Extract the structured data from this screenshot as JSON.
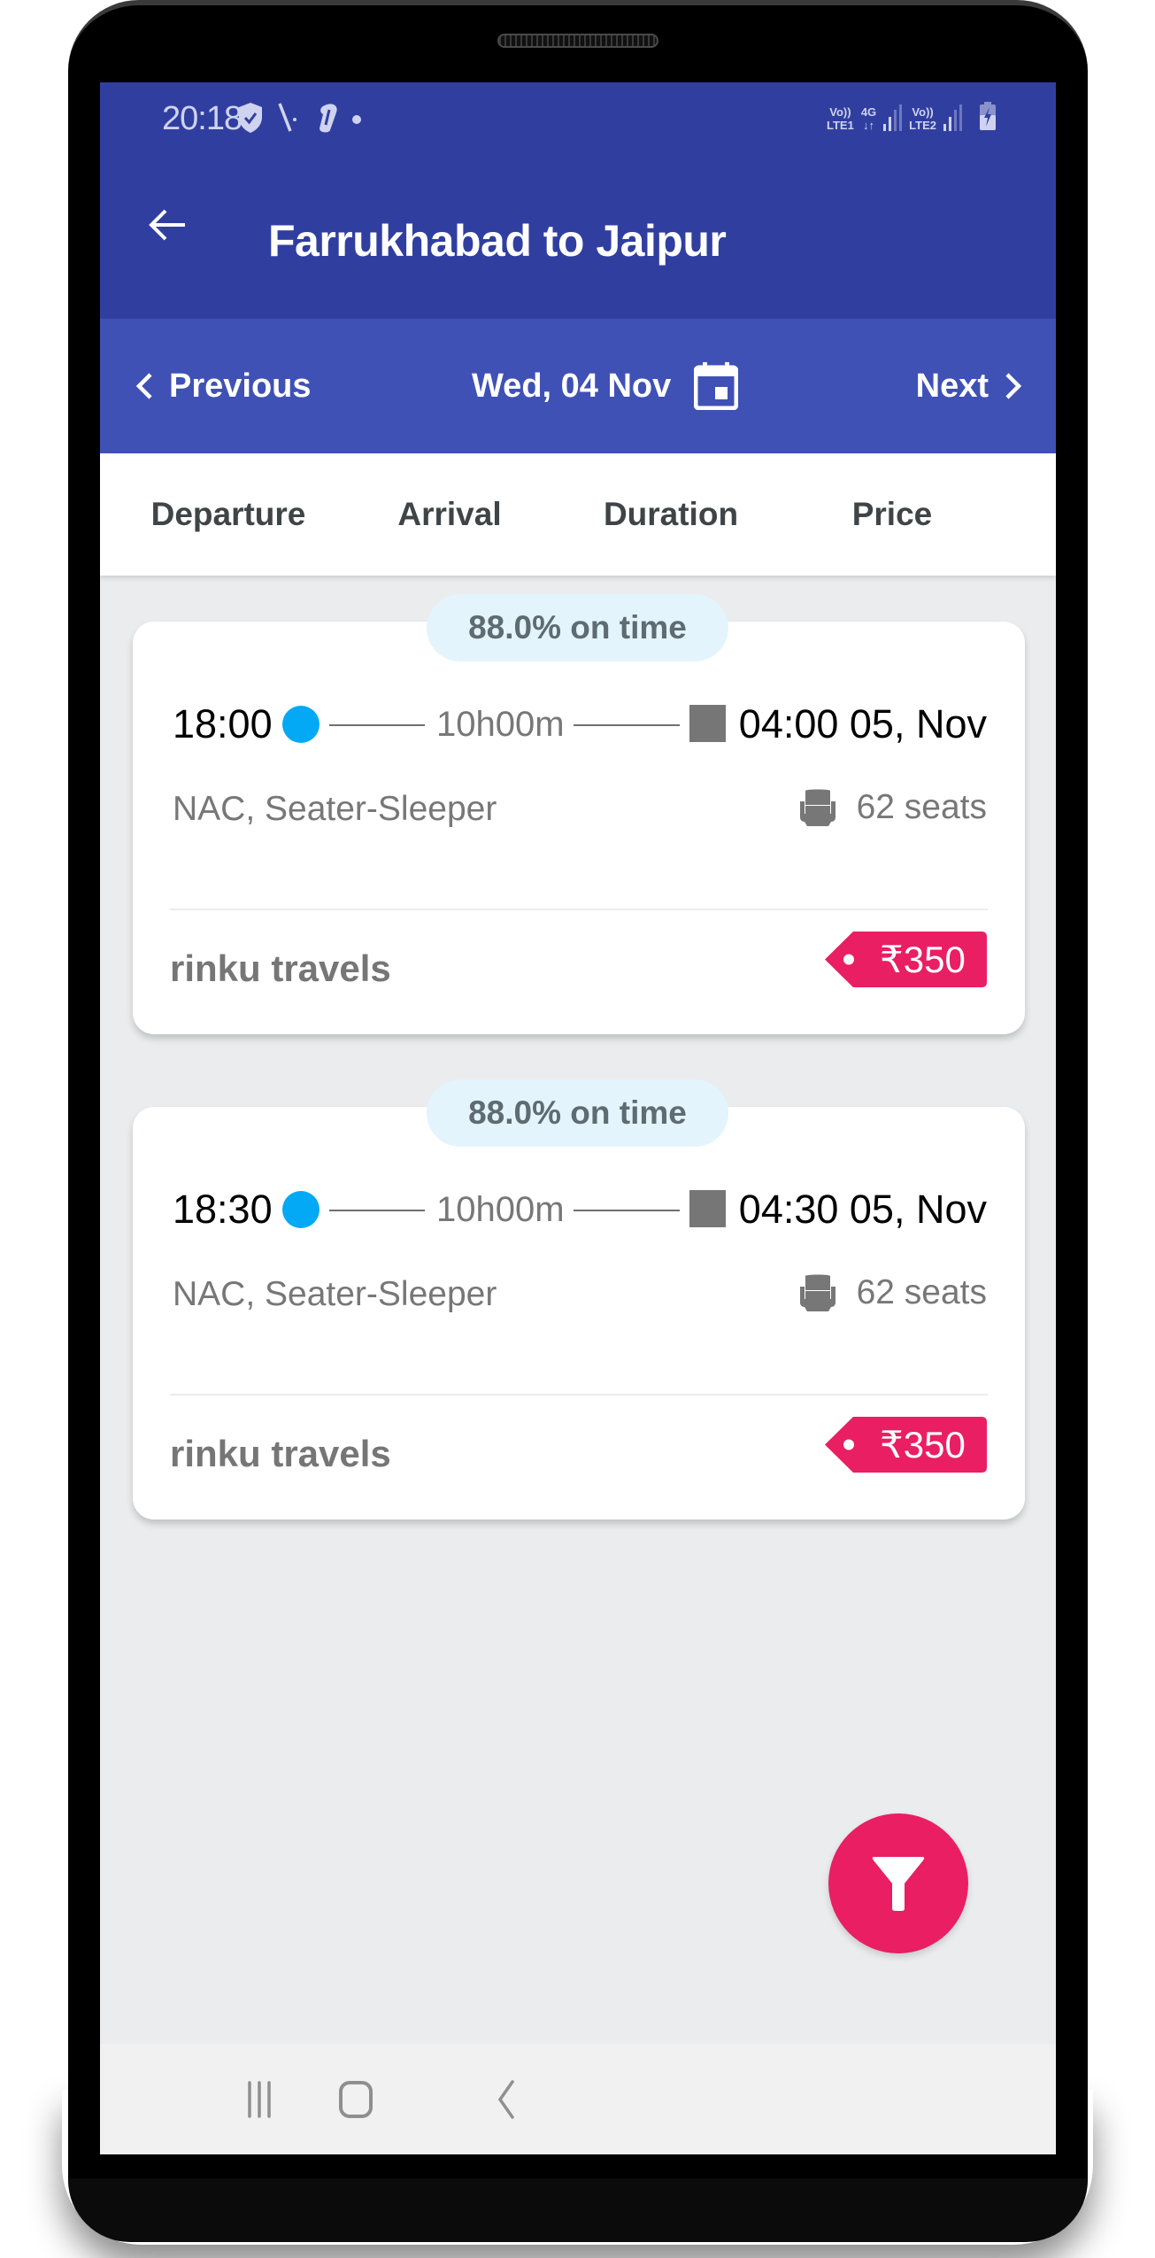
{
  "status_bar": {
    "time": "20:18",
    "left_icons": [
      "shield-check-icon",
      "signal-antenna-icon",
      "app-notification-icon",
      "dot-icon"
    ],
    "sim1_label_top": "Vo))",
    "sim1_label_bottom": "LTE1",
    "data_label_top": "4G",
    "data_label_bottom": "↓↑",
    "sim2_label_top": "Vo))",
    "sim2_label_bottom": "LTE2",
    "battery": "charging"
  },
  "toolbar": {
    "title": "Farrukhabad to Jaipur",
    "back_icon": "arrow-back-icon"
  },
  "date_bar": {
    "previous_label": "Previous",
    "date": "Wed, 04 Nov",
    "next_label": "Next"
  },
  "sort_tabs": [
    {
      "label": "Departure"
    },
    {
      "label": "Arrival"
    },
    {
      "label": "Duration"
    },
    {
      "label": "Price"
    }
  ],
  "results": [
    {
      "on_time": "88.0% on time",
      "departure": "18:00",
      "duration": "10h00m",
      "arrival": "04:00 05, Nov",
      "bus_type": "NAC, Seater-Sleeper",
      "seats": "62 seats",
      "operator": "rinku travels",
      "price": "₹350"
    },
    {
      "on_time": "88.0% on time",
      "departure": "18:30",
      "duration": "10h00m",
      "arrival": "04:30 05, Nov",
      "bus_type": "NAC, Seater-Sleeper",
      "seats": "62 seats",
      "operator": "rinku travels",
      "price": "₹350"
    }
  ],
  "fab": {
    "icon": "filter-icon"
  },
  "nav_bar": {
    "buttons": [
      "recent-apps-icon",
      "home-icon",
      "back-icon"
    ]
  },
  "colors": {
    "primary_dark": "#303f9f",
    "primary": "#3f51b5",
    "accent": "#e91e63",
    "departure_dot": "#03a9f4",
    "badge_bg": "#e3f4fc"
  }
}
